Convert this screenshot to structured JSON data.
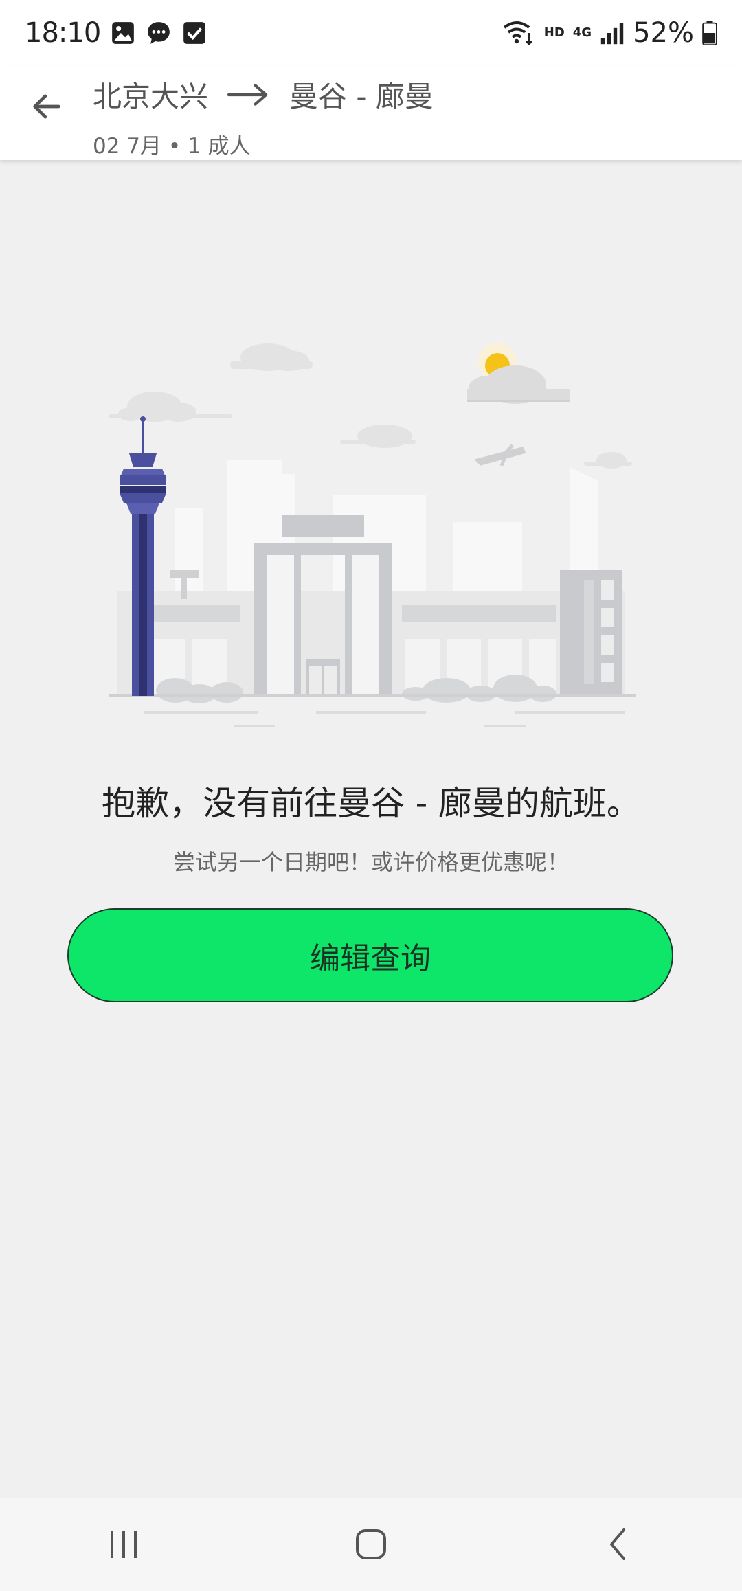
{
  "status_bar": {
    "time": "18:10",
    "network_label": "HD",
    "cell_label": "4G",
    "battery_percent": "52%",
    "icons": [
      "image-icon",
      "message-icon",
      "checkbox-icon",
      "wifi-icon",
      "signal-icon",
      "battery-icon"
    ]
  },
  "header": {
    "origin": "北京大兴",
    "destination": "曼谷 - 廊曼",
    "subline": "02 7月 • 1 成人"
  },
  "empty_state": {
    "title": "抱歉，没有前往曼谷 - 廊曼的航班。",
    "subtitle": "尝试另一个日期吧！或许价格更优惠呢！",
    "button_label": "编辑查询"
  },
  "colors": {
    "accent_green": "#0ee66a",
    "tower_blue": "#4a4f9e",
    "background": "#f0f0f0"
  }
}
